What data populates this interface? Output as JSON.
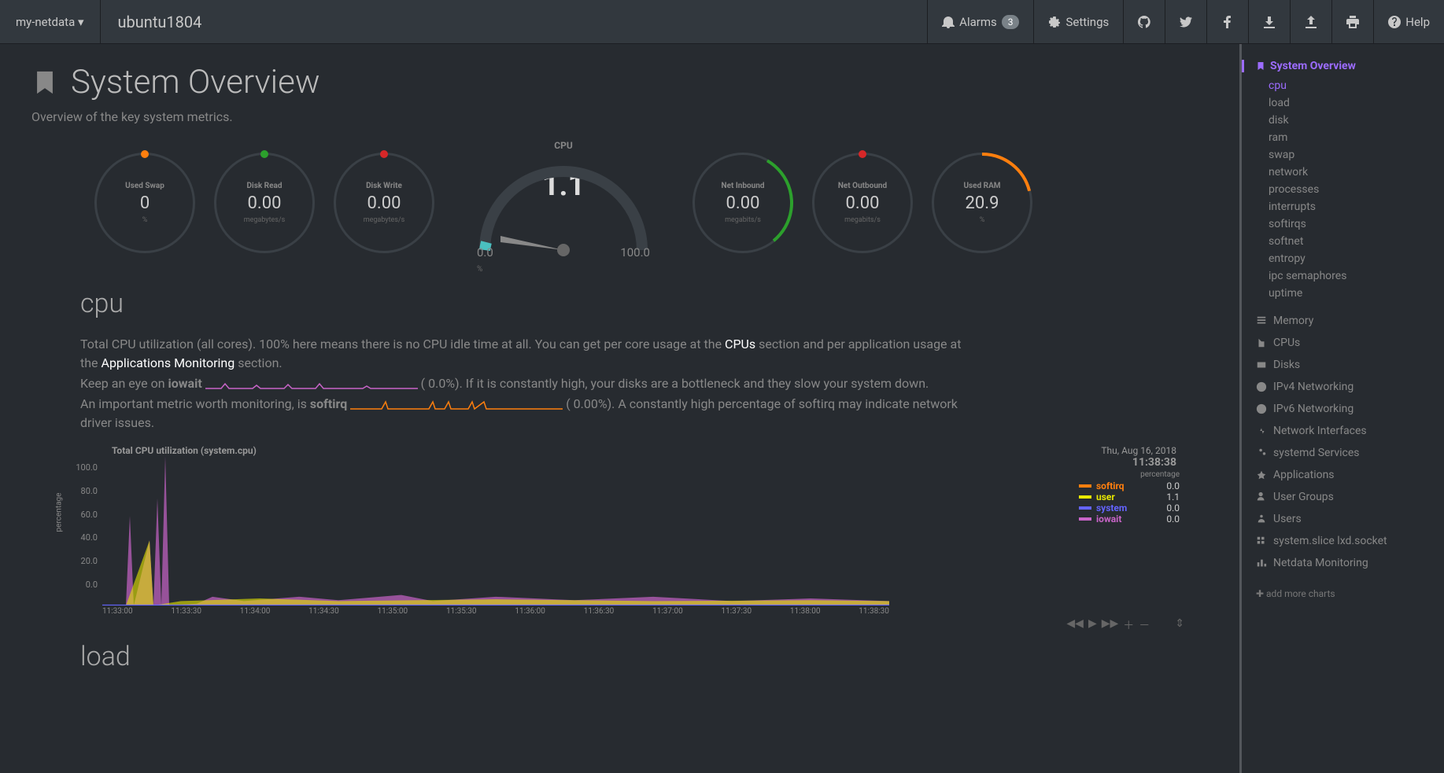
{
  "topbar": {
    "brand": "my-netdata",
    "hostname": "ubuntu1804",
    "alarms_label": "Alarms",
    "alarms_count": "3",
    "settings_label": "Settings",
    "help_label": "Help"
  },
  "page": {
    "title": "System Overview",
    "subtitle": "Overview of the key system metrics."
  },
  "gauges": {
    "used_swap": {
      "title": "Used Swap",
      "value": "0",
      "unit": "%",
      "tick_color": "#ff7f0e"
    },
    "disk_read": {
      "title": "Disk Read",
      "value": "0.00",
      "unit": "megabytes/s",
      "tick_color": "#2ca02c"
    },
    "disk_write": {
      "title": "Disk Write",
      "value": "0.00",
      "unit": "megabytes/s",
      "tick_color": "#d62728"
    },
    "cpu": {
      "title": "CPU",
      "value": "1.1",
      "min": "0.0",
      "max": "100.0",
      "unit": "%"
    },
    "net_in": {
      "title": "Net Inbound",
      "value": "0.00",
      "unit": "megabits/s",
      "arc_color": "#2ca02c"
    },
    "net_out": {
      "title": "Net Outbound",
      "value": "0.00",
      "unit": "megabits/s",
      "tick_color": "#d62728"
    },
    "used_ram": {
      "title": "Used RAM",
      "value": "20.9",
      "unit": "%",
      "arc_color": "#ff7f0e"
    }
  },
  "cpu_section": {
    "heading": "cpu",
    "p1a": "Total CPU utilization (all cores). 100% here means there is no CPU idle time at all. You can get per core usage at the ",
    "p1_link1": "CPUs",
    "p1b": " section and per application usage at the ",
    "p1_link2": "Applications Monitoring",
    "p1c": " section.",
    "p2a": "Keep an eye on ",
    "p2_metric": "iowait",
    "p2b": "0.0%). If it is constantly high, your disks are a bottleneck and they slow your system down.",
    "p3a": "An important metric worth monitoring, is ",
    "p3_metric": "softirq",
    "p3b": "0.00%). A constantly high percentage of softirq may indicate network driver issues."
  },
  "chart_data": {
    "type": "area",
    "title": "Total CPU utilization (system.cpu)",
    "ylabel": "percentage",
    "ylim": [
      0,
      100
    ],
    "yticks": [
      "100.0",
      "80.0",
      "60.0",
      "40.0",
      "20.0",
      "0.0"
    ],
    "xticks": [
      "11:33:00",
      "11:33:30",
      "11:34:00",
      "11:34:30",
      "11:35:00",
      "11:35:30",
      "11:36:00",
      "11:36:30",
      "11:37:00",
      "11:37:30",
      "11:38:00",
      "11:38:30"
    ],
    "date": "Thu, Aug 16, 2018",
    "time": "11:38:38",
    "legend_header": "percentage",
    "series": [
      {
        "name": "softirq",
        "color": "#ff7f0e",
        "value": "0.0"
      },
      {
        "name": "user",
        "color": "#e8e800",
        "value": "1.1"
      },
      {
        "name": "system",
        "color": "#6464ff",
        "value": "0.0"
      },
      {
        "name": "iowait",
        "color": "#c864c8",
        "value": "0.0"
      }
    ]
  },
  "load_section": {
    "heading": "load"
  },
  "sidebar": {
    "active": "System Overview",
    "subs": [
      "cpu",
      "load",
      "disk",
      "ram",
      "swap",
      "network",
      "processes",
      "interrupts",
      "softirqs",
      "softnet",
      "entropy",
      "ipc semaphores",
      "uptime"
    ],
    "items": [
      "Memory",
      "CPUs",
      "Disks",
      "IPv4 Networking",
      "IPv6 Networking",
      "Network Interfaces",
      "systemd Services",
      "Applications",
      "User Groups",
      "Users",
      "system.slice lxd.socket",
      "Netdata Monitoring"
    ],
    "footer": "add more charts"
  }
}
